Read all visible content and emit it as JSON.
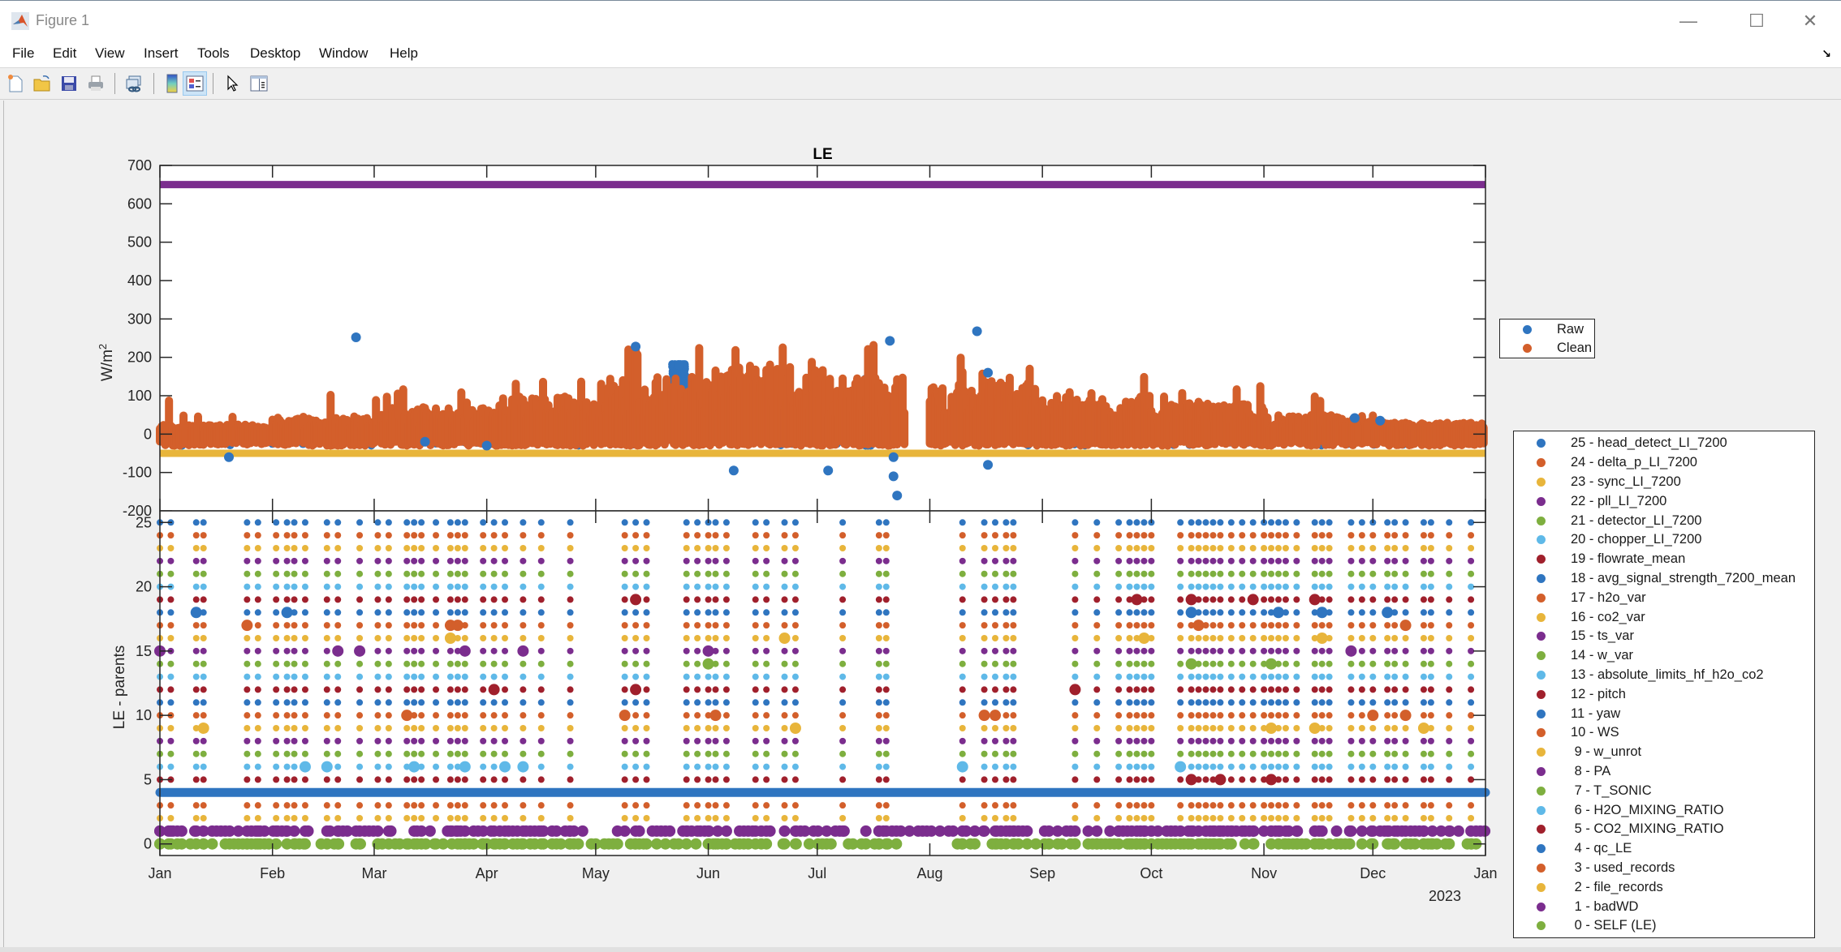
{
  "window": {
    "title": "Figure 1",
    "controls": {
      "minimize": "—",
      "maximize": "☐",
      "close": "✕"
    }
  },
  "menu": [
    "File",
    "Edit",
    "View",
    "Insert",
    "Tools",
    "Desktop",
    "Window",
    "Help"
  ],
  "toolbar": [
    {
      "icon": "new-figure-icon"
    },
    {
      "icon": "open-file-icon"
    },
    {
      "icon": "save-icon"
    },
    {
      "icon": "print-icon"
    },
    {
      "icon": "link-plot-icon"
    },
    {
      "icon": "colorbar-icon"
    },
    {
      "icon": "legend-icon",
      "active": true
    },
    {
      "icon": "edit-plot-pointer-icon"
    },
    {
      "icon": "property-inspector-icon"
    }
  ],
  "colors": {
    "blue": "#2f75c0",
    "orange": "#d35f2b",
    "yellow": "#e8b53b",
    "purple": "#7b2d8e",
    "green": "#7eaf3f",
    "cyan": "#5fb9e8",
    "maroon": "#a0202c"
  },
  "chart_data": [
    {
      "type": "scatter",
      "title": "LE",
      "xlabel": "",
      "ylabel": "W/m^2",
      "ylim": [
        -200,
        700
      ],
      "yticks": [
        -200,
        -100,
        0,
        100,
        200,
        300,
        400,
        500,
        600,
        700
      ],
      "xlim": [
        "2022-01-01",
        "2023-01-01"
      ],
      "xticks": [
        "Jan",
        "Feb",
        "Mar",
        "Apr",
        "May",
        "Jun",
        "Jul",
        "Aug",
        "Sep",
        "Oct",
        "Nov",
        "Dec",
        "Jan"
      ],
      "x_secondary_label": "2023",
      "legend": {
        "placement": "outside-right",
        "entries": [
          {
            "label": "Raw",
            "color": "#2f75c0"
          },
          {
            "label": "Clean",
            "color": "#d35f2b"
          }
        ]
      },
      "reference_lines": [
        {
          "name": "upper-limit",
          "y": 650,
          "color": "#7b2d8e"
        },
        {
          "name": "lower-limit",
          "y": -50,
          "color": "#e8b53b"
        }
      ],
      "series": [
        {
          "name": "Clean",
          "color": "#d35f2b",
          "description": "half-hourly LE; monthly envelope of max values (W/m2)",
          "monthly_max": [
            90,
            110,
            130,
            160,
            240,
            240,
            245,
            200,
            150,
            130,
            100,
            60
          ],
          "monthly_typical_max": [
            25,
            45,
            70,
            100,
            150,
            180,
            150,
            140,
            100,
            80,
            50,
            30
          ],
          "min": -30
        },
        {
          "name": "Raw",
          "color": "#2f75c0",
          "outliers": [
            {
              "date": "2022-01-20",
              "y": -60
            },
            {
              "date": "2022-02-24",
              "y": 252
            },
            {
              "date": "2022-03-15",
              "y": -20
            },
            {
              "date": "2022-04-01",
              "y": -30
            },
            {
              "date": "2022-05-12",
              "y": 228
            },
            {
              "date": "2022-05-24",
              "y": 180
            },
            {
              "date": "2022-06-08",
              "y": -95
            },
            {
              "date": "2022-07-04",
              "y": -95
            },
            {
              "date": "2022-07-21",
              "y": 243
            },
            {
              "date": "2022-07-22",
              "y": -60
            },
            {
              "date": "2022-07-22",
              "y": -110
            },
            {
              "date": "2022-07-23",
              "y": -160
            },
            {
              "date": "2022-08-14",
              "y": 268
            },
            {
              "date": "2022-08-17",
              "y": -80
            },
            {
              "date": "2022-08-17",
              "y": 160
            },
            {
              "date": "2022-11-26",
              "y": 42
            },
            {
              "date": "2022-12-03",
              "y": 35
            }
          ],
          "dense_bands": [
            {
              "from": "2022-05-22",
              "to": "2022-05-26",
              "ymin": -10,
              "ymax": 185
            },
            {
              "from": "2022-07-14",
              "to": "2022-07-16",
              "ymin": -30,
              "ymax": 145
            }
          ]
        }
      ]
    },
    {
      "type": "scatter",
      "title": "",
      "xlabel": "",
      "ylabel": "LE - parents",
      "ylim": [
        -0.9,
        25.9
      ],
      "yticks": [
        0,
        5,
        10,
        15,
        20,
        25
      ],
      "xticks": [
        "Jan",
        "Feb",
        "Mar",
        "Apr",
        "May",
        "Jun",
        "Jul",
        "Aug",
        "Sep",
        "Oct",
        "Nov",
        "Dec",
        "Jan"
      ],
      "x_secondary_label": "2023",
      "legend": {
        "placement": "outside-right",
        "entries": [
          {
            "label": "25 - head_detect_LI_7200",
            "color": "#2f75c0"
          },
          {
            "label": "24 - delta_p_LI_7200",
            "color": "#d35f2b"
          },
          {
            "label": "23 - sync_LI_7200",
            "color": "#e8b53b"
          },
          {
            "label": "22 - pll_LI_7200",
            "color": "#7b2d8e"
          },
          {
            "label": "21 - detector_LI_7200",
            "color": "#7eaf3f"
          },
          {
            "label": "20 - chopper_LI_7200",
            "color": "#5fb9e8"
          },
          {
            "label": "19 - flowrate_mean",
            "color": "#a0202c"
          },
          {
            "label": "18 - avg_signal_strength_7200_mean",
            "color": "#2f75c0"
          },
          {
            "label": "17 - h2o_var",
            "color": "#d35f2b"
          },
          {
            "label": "16 - co2_var",
            "color": "#e8b53b"
          },
          {
            "label": "15 - ts_var",
            "color": "#7b2d8e"
          },
          {
            "label": "14 - w_var",
            "color": "#7eaf3f"
          },
          {
            "label": "13 - absolute_limits_hf_h2o_co2",
            "color": "#5fb9e8"
          },
          {
            "label": "12 - pitch",
            "color": "#a0202c"
          },
          {
            "label": "11 - yaw",
            "color": "#2f75c0"
          },
          {
            "label": "10 - WS",
            "color": "#d35f2b"
          },
          {
            "label": " 9 - w_unrot",
            "color": "#e8b53b"
          },
          {
            "label": " 8 - PA",
            "color": "#7b2d8e"
          },
          {
            "label": " 7 - T_SONIC",
            "color": "#7eaf3f"
          },
          {
            "label": " 6 - H2O_MIXING_RATIO",
            "color": "#5fb9e8"
          },
          {
            "label": " 5 - CO2_MIXING_RATIO",
            "color": "#a0202c"
          },
          {
            "label": " 4 - qc_LE",
            "color": "#2f75c0"
          },
          {
            "label": " 3 - used_records",
            "color": "#d35f2b"
          },
          {
            "label": " 2 - file_records",
            "color": "#e8b53b"
          },
          {
            "label": " 1 - badWD",
            "color": "#7b2d8e"
          },
          {
            "label": " 0 - SELF (LE)",
            "color": "#7eaf3f"
          }
        ]
      },
      "series_description": "each parent flag index (0-25) plotted as a row of dots on days it was flagged; row 4 (qc_LE) continuous all year; rows 0 and 1 dense; gap in all flag rows ~Jul 25 - Aug 8",
      "data_gap": {
        "from": "2022-07-25",
        "to": "2022-08-08"
      },
      "continuous_rows": [
        4
      ],
      "dense_rows": [
        0,
        1
      ]
    }
  ]
}
